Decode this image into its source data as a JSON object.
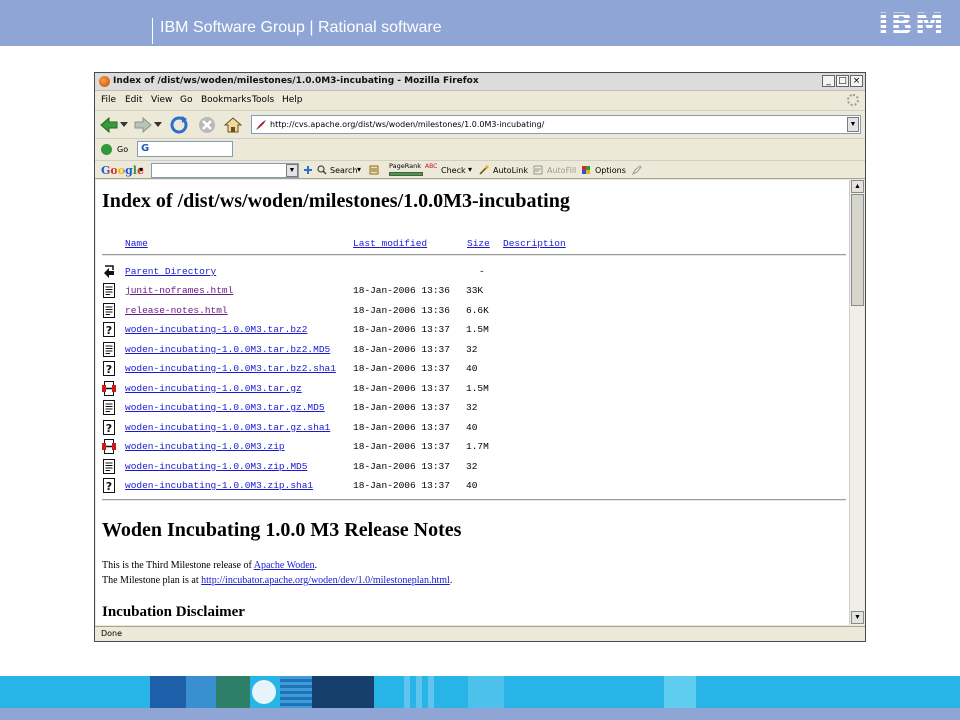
{
  "slide": {
    "header_title": "IBM Software Group | Rational software",
    "logo_text": "IBM",
    "colors": {
      "header": "#8fa5d6",
      "footer": "#28b4e6"
    }
  },
  "browser": {
    "title": "Index of /dist/ws/woden/milestones/1.0.0M3-incubating - Mozilla Firefox",
    "window_buttons": {
      "minimize": "_",
      "maximize": "□",
      "close": "×"
    },
    "menu": [
      "File",
      "Edit",
      "View",
      "Go",
      "Bookmarks",
      "Tools",
      "Help"
    ],
    "url": "http://cvs.apache.org/dist/ws/woden/milestones/1.0.0M3-incubating/",
    "go_label": "Go",
    "go_field_icon": "G",
    "google": {
      "logo": "Google",
      "search": "Search",
      "pagerank": "PageRank",
      "check": "Check",
      "autolink": "AutoLink",
      "autofill": "AutoFill",
      "options": "Options"
    },
    "status": "Done"
  },
  "page": {
    "title": "Index of /dist/ws/woden/milestones/1.0.0M3-incubating",
    "columns": {
      "name": "Name",
      "modified": "Last modified",
      "size": "Size",
      "description": "Description"
    },
    "parent": {
      "name": "Parent Directory",
      "size": "-"
    },
    "files": [
      {
        "icon": "text-file",
        "name": "junit-noframes.html",
        "modified": "18-Jan-2006 13:36",
        "size": "33K",
        "visited": true
      },
      {
        "icon": "text-file",
        "name": "release-notes.html",
        "modified": "18-Jan-2006 13:36",
        "size": "6.6K",
        "visited": true
      },
      {
        "icon": "unknown-file",
        "name": "woden-incubating-1.0.0M3.tar.bz2",
        "modified": "18-Jan-2006 13:37",
        "size": "1.5M"
      },
      {
        "icon": "text-file",
        "name": "woden-incubating-1.0.0M3.tar.bz2.MD5",
        "modified": "18-Jan-2006 13:37",
        "size": "32"
      },
      {
        "icon": "unknown-file",
        "name": "woden-incubating-1.0.0M3.tar.bz2.sha1",
        "modified": "18-Jan-2006 13:37",
        "size": "40"
      },
      {
        "icon": "compressed-file",
        "name": "woden-incubating-1.0.0M3.tar.gz",
        "modified": "18-Jan-2006 13:37",
        "size": "1.5M"
      },
      {
        "icon": "text-file",
        "name": "woden-incubating-1.0.0M3.tar.gz.MD5",
        "modified": "18-Jan-2006 13:37",
        "size": "32"
      },
      {
        "icon": "unknown-file",
        "name": "woden-incubating-1.0.0M3.tar.gz.sha1",
        "modified": "18-Jan-2006 13:37",
        "size": "40"
      },
      {
        "icon": "compressed-file",
        "name": "woden-incubating-1.0.0M3.zip",
        "modified": "18-Jan-2006 13:37",
        "size": "1.7M"
      },
      {
        "icon": "text-file",
        "name": "woden-incubating-1.0.0M3.zip.MD5",
        "modified": "18-Jan-2006 13:37",
        "size": "32"
      },
      {
        "icon": "unknown-file",
        "name": "woden-incubating-1.0.0M3.zip.sha1",
        "modified": "18-Jan-2006 13:37",
        "size": "40"
      }
    ],
    "notes_title": "Woden Incubating 1.0.0 M3 Release Notes",
    "para1_prefix": "This is the Third Milestone release of ",
    "para1_link": "Apache Woden",
    "para1_suffix": ".",
    "para2_prefix": "The Milestone plan is at ",
    "para2_link": "http://incubator.apache.org/woden/dev/1.0/milestoneplan.html",
    "para2_suffix": ".",
    "disclaimer_heading": "Incubation Disclaimer"
  }
}
